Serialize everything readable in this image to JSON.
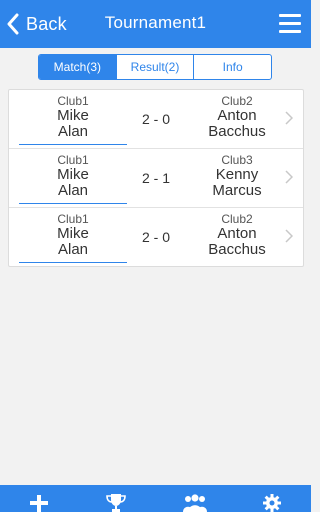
{
  "header": {
    "back_label": "Back",
    "title": "Tournament1"
  },
  "tabs": [
    {
      "label": "Match(3)",
      "active": true
    },
    {
      "label": "Result(2)",
      "active": false
    },
    {
      "label": "Info",
      "active": false
    }
  ],
  "matches": [
    {
      "home_club": "Club1",
      "home_first": "Mike",
      "home_last": "Alan",
      "score": "2 - 0",
      "away_club": "Club2",
      "away_first": "Anton",
      "away_last": "Bacchus"
    },
    {
      "home_club": "Club1",
      "home_first": "Mike",
      "home_last": "Alan",
      "score": "2 - 1",
      "away_club": "Club3",
      "away_first": "Kenny",
      "away_last": "Marcus"
    },
    {
      "home_club": "Club1",
      "home_first": "Mike",
      "home_last": "Alan",
      "score": "2 - 0",
      "away_club": "Club2",
      "away_first": "Anton",
      "away_last": "Bacchus"
    }
  ],
  "bottom_nav": [
    "plus-icon",
    "trophy-icon",
    "people-icon",
    "gear-icon"
  ],
  "colors": {
    "accent": "#2f85ea",
    "background": "#f2f2f2"
  }
}
